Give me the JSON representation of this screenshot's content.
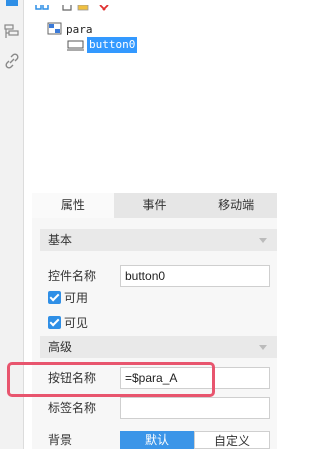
{
  "colors": {
    "accent": "#2f8fe6",
    "highlight": "#e8556e"
  },
  "left_strip": {
    "icons": [
      "component-icon",
      "link-icon"
    ]
  },
  "toolbar": {
    "icons": [
      "expand-icon",
      "copy-icon",
      "paste-icon",
      "delete-icon"
    ]
  },
  "tree": {
    "root": {
      "icon": "form-icon",
      "label": "para"
    },
    "child": {
      "icon": "button-widget-icon",
      "label": "button0"
    }
  },
  "tabs": [
    {
      "label": "属性",
      "active": true
    },
    {
      "label": "事件",
      "active": false
    },
    {
      "label": "移动端",
      "active": false
    }
  ],
  "basic": {
    "title": "基本",
    "widget_name_label": "控件名称",
    "widget_name_value": "button0",
    "enabled_label": "可用",
    "visible_label": "可见"
  },
  "advanced": {
    "title": "高级",
    "button_name_label": "按钮名称",
    "button_name_value": "=$para_A",
    "tag_name_label": "标签名称",
    "tag_name_value": "",
    "background_label": "背景",
    "background_default": "默认",
    "background_custom": "自定义"
  }
}
